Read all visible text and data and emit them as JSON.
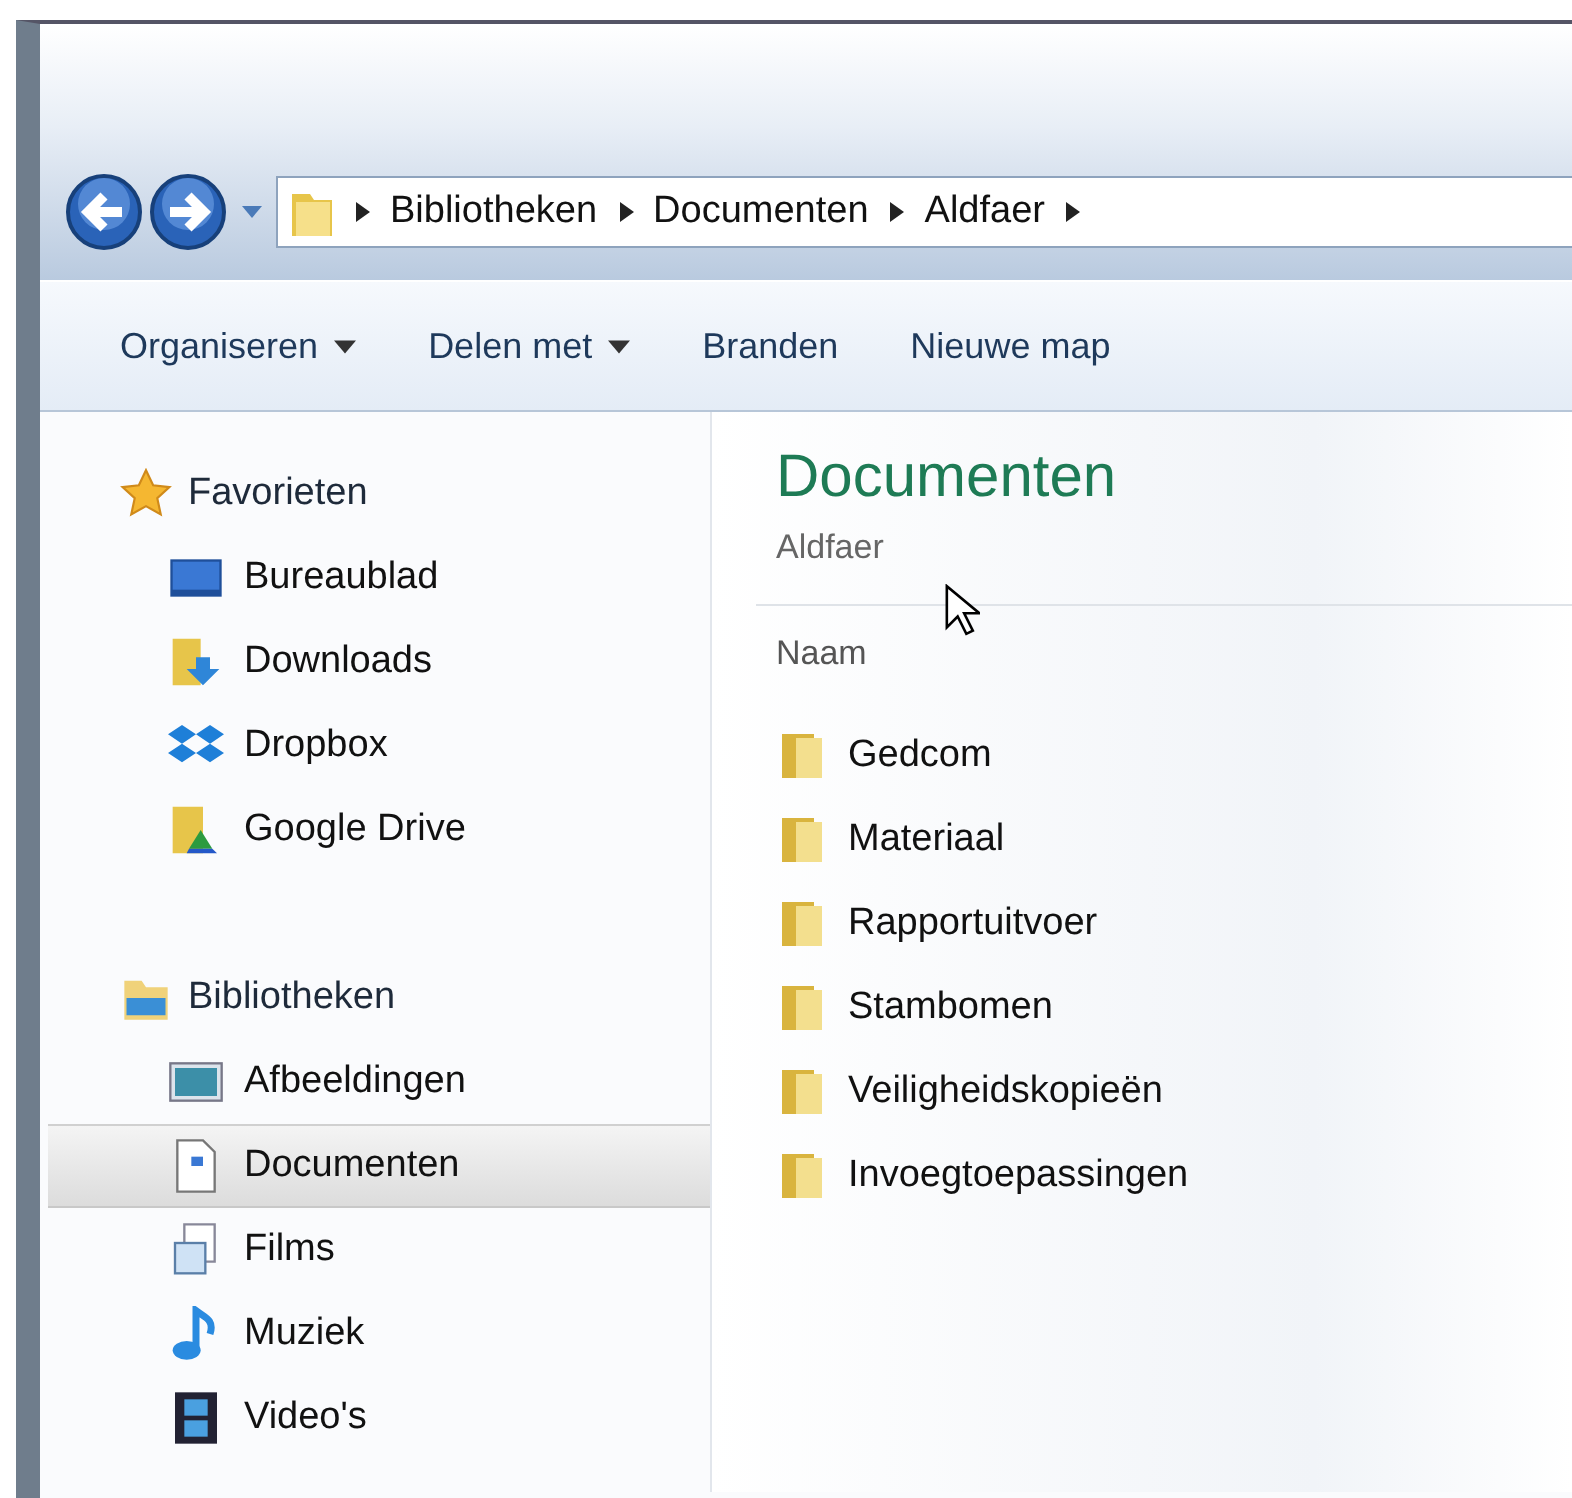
{
  "address_bar": {
    "segments": [
      "Bibliotheken",
      "Documenten",
      "Aldfaer"
    ]
  },
  "toolbar": {
    "items": [
      {
        "label": "Organiseren",
        "dropdown": true
      },
      {
        "label": "Delen met",
        "dropdown": true
      },
      {
        "label": "Branden",
        "dropdown": false
      },
      {
        "label": "Nieuwe map",
        "dropdown": false
      }
    ]
  },
  "sidebar": {
    "groups": [
      {
        "label": "Favorieten",
        "items": [
          {
            "label": "Bureaublad",
            "selected": false
          },
          {
            "label": "Downloads",
            "selected": false
          },
          {
            "label": "Dropbox",
            "selected": false
          },
          {
            "label": "Google Drive",
            "selected": false
          }
        ]
      },
      {
        "label": "Bibliotheken",
        "items": [
          {
            "label": "Afbeeldingen",
            "selected": false
          },
          {
            "label": "Documenten",
            "selected": true
          },
          {
            "label": "Films",
            "selected": false
          },
          {
            "label": "Muziek",
            "selected": false
          },
          {
            "label": "Video's",
            "selected": false
          }
        ]
      }
    ]
  },
  "content": {
    "title": "Documenten",
    "subtitle": "Aldfaer",
    "column": "Naam",
    "files": [
      "Gedcom",
      "Materiaal",
      "Rapportuitvoer",
      "Stambomen",
      "Veiligheidskopieën",
      "Invoegtoepassingen"
    ]
  }
}
